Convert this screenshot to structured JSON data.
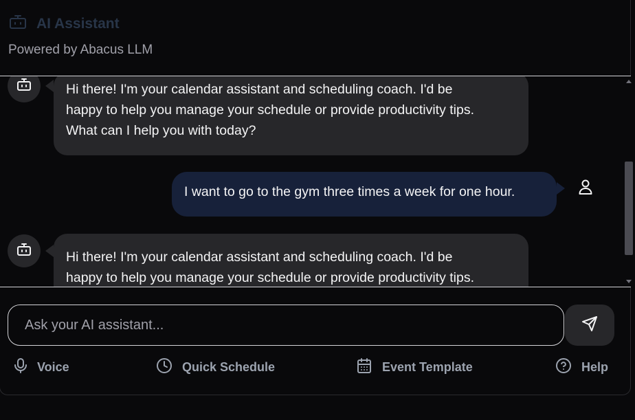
{
  "header": {
    "title": "AI Assistant",
    "subtitle": "Powered by Abacus LLM",
    "icon": "bot-icon"
  },
  "messages": [
    {
      "role": "assistant",
      "lines": [
        "Hi there! I'm your calendar assistant and scheduling coach. I'd be",
        "happy to help you manage your schedule or provide productivity tips.",
        "What can I help you with today?"
      ]
    },
    {
      "role": "user",
      "lines": [
        "I want to go to the gym three times a week for one hour."
      ]
    },
    {
      "role": "assistant",
      "lines": [
        "Hi there! I'm your calendar assistant and scheduling coach. I'd be",
        "happy to help you manage your schedule or provide productivity tips."
      ]
    }
  ],
  "composer": {
    "placeholder": "Ask your AI assistant...",
    "value": "",
    "send_icon": "send-icon"
  },
  "toolbar": {
    "voice_label": "Voice",
    "quick_schedule_label": "Quick Schedule",
    "event_template_label": "Event Template",
    "help_label": "Help"
  },
  "colors": {
    "background": "#09090b",
    "assistant_bubble": "#27272a",
    "user_bubble": "#17213a",
    "muted_text": "#9ca3af",
    "title_text": "#283548"
  }
}
